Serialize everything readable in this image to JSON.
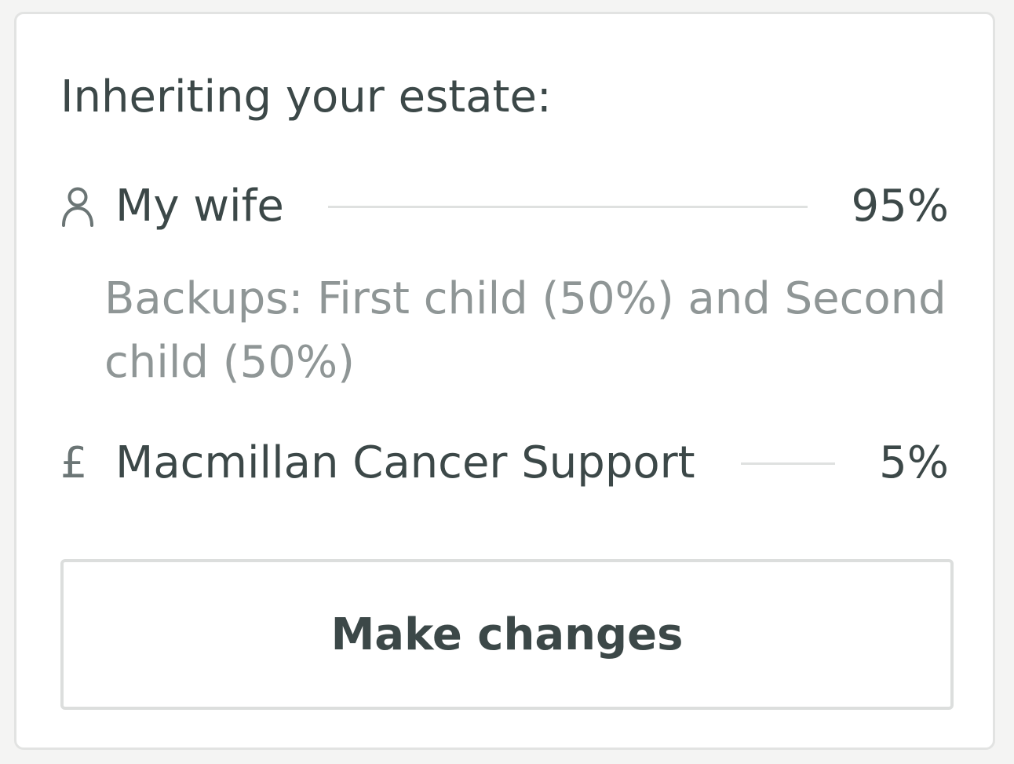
{
  "card": {
    "heading": "Inheriting your estate:",
    "beneficiaries": [
      {
        "icon": "person-icon",
        "name": "My wife",
        "share": "95%",
        "backups": "Backups: First child (50%) and Second child (50%)"
      },
      {
        "icon": "pound-icon",
        "icon_glyph": "£",
        "name": "Macmillan Cancer Support",
        "share": "5%"
      }
    ],
    "action_label": "Make changes"
  },
  "colors": {
    "text": "#3c4848",
    "muted_text": "#8f9696",
    "icon": "#6b7575",
    "border": "#dcdedd",
    "background": "#f4f4f3"
  }
}
